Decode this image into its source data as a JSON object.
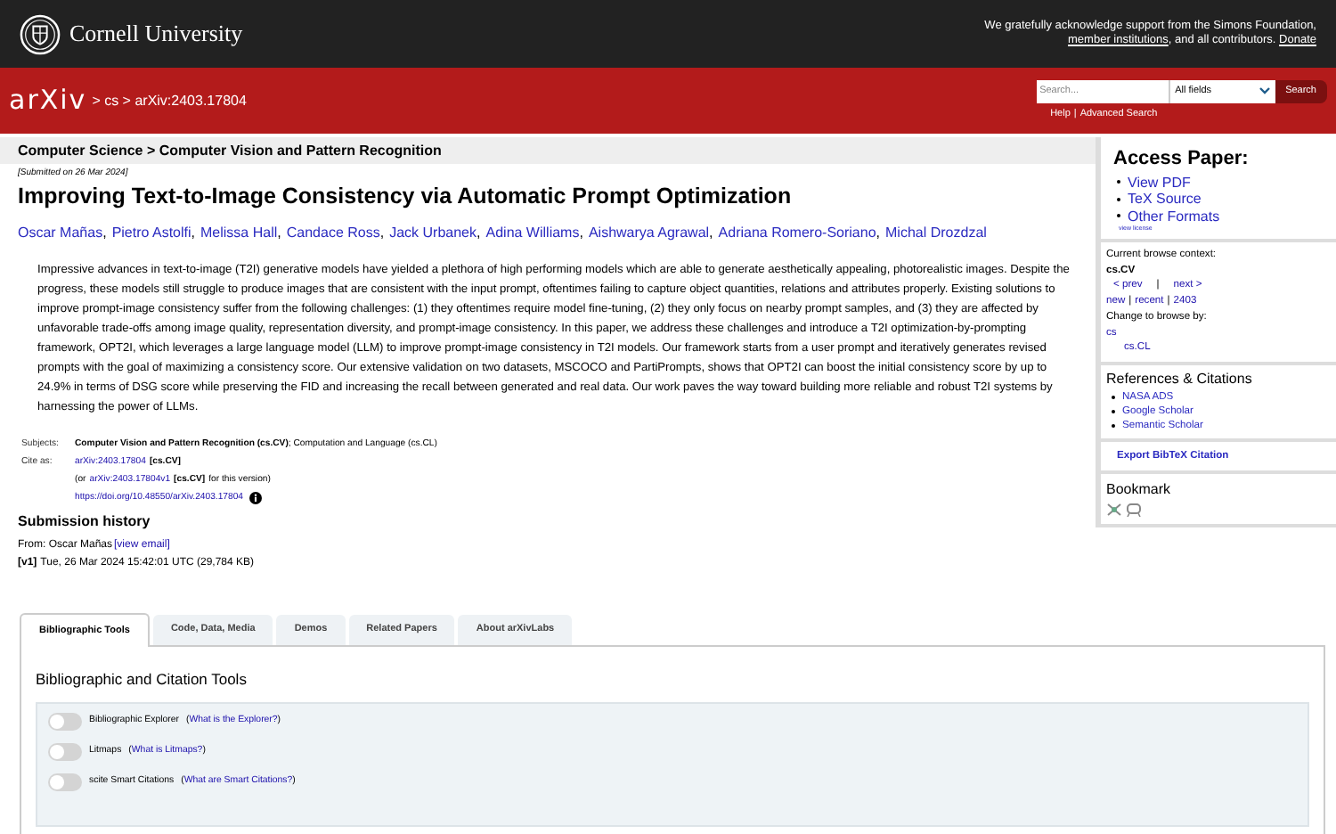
{
  "top_bar": {
    "institution": "Cornell University",
    "acknowledgment": [
      {
        "kind": "text",
        "text": "We gratefully acknowledge support from the Simons Foundation, "
      },
      {
        "kind": "link",
        "text": "member institutions"
      },
      {
        "kind": "text",
        "text": ", and all contributors. "
      },
      {
        "kind": "link",
        "text": "Donate"
      }
    ]
  },
  "nav_bar": {
    "logo": "arXiv",
    "breadcrumb": "> cs > arXiv:2403.17804",
    "search": {
      "placeholder": "Search...",
      "field_select": "All fields",
      "button": "Search"
    },
    "links": [
      "Help",
      "Advanced Search"
    ],
    "separator": "|"
  },
  "subheader": "Computer Science > Computer Vision and Pattern Recognition",
  "paper": {
    "submitted": "[Submitted on 26 Mar 2024]",
    "title": "Improving Text-to-Image Consistency via Automatic Prompt Optimization",
    "authors": [
      "Oscar Mañas",
      "Pietro Astolfi",
      "Melissa Hall",
      "Candace Ross",
      "Jack Urbanek",
      "Adina Williams",
      "Aishwarya Agrawal",
      "Adriana Romero-Soriano",
      "Michal Drozdzal"
    ],
    "author_separator": ",",
    "abstract": "Impressive advances in text-to-image (T2I) generative models have yielded a plethora of high performing models which are able to generate aesthetically appealing, photorealistic images. Despite the progress, these models still struggle to produce images that are consistent with the input prompt, oftentimes failing to capture object quantities, relations and attributes properly. Existing solutions to improve prompt-image consistency suffer from the following challenges: (1) they oftentimes require model fine-tuning, (2) they only focus on nearby prompt samples, and (3) they are affected by unfavorable trade-offs among image quality, representation diversity, and prompt-image consistency. In this paper, we address these challenges and introduce a T2I optimization-by-prompting framework, OPT2I, which leverages a large language model (LLM) to improve prompt-image consistency in T2I models. Our framework starts from a user prompt and iteratively generates revised prompts with the goal of maximizing a consistency score. Our extensive validation on two datasets, MSCOCO and PartiPrompts, shows that OPT2I can boost the initial consistency score by up to 24.9% in terms of DSG score while preserving the FID and increasing the recall between generated and real data. Our work paves the way toward building more reliable and robust T2I systems by harnessing the power of LLMs.",
    "subjects_label": "Subjects:",
    "subjects": "**Computer Vision and Pattern Recognition (cs.CV)**; Computation and Language (cs.CL)",
    "cite_label": "Cite as:",
    "cite_id": "arXiv:2403.17804",
    "cite_tag": "[cs.CV]",
    "version_open": "(or",
    "version_id": "arXiv:2403.17804v1",
    "version_tag": "[cs.CV]",
    "version_close": "for this version)",
    "doi": "https://doi.org/10.48550/arXiv.2403.17804"
  },
  "submission_history": {
    "heading": "Submission history",
    "from": "From: Oscar Mañas",
    "view_email": "[view email]",
    "version_tag": "[v1]",
    "version_text": "Tue, 26 Mar 2024 15:42:01 UTC (29,784 KB)"
  },
  "tabs": [
    {
      "label": "Bibliographic Tools",
      "selected": true
    },
    {
      "label": "Code, Data, Media",
      "selected": false
    },
    {
      "label": "Demos",
      "selected": false
    },
    {
      "label": "Related Papers",
      "selected": false
    },
    {
      "label": "About arXivLabs",
      "selected": false
    }
  ],
  "tools_panel": {
    "heading": "Bibliographic and Citation Tools",
    "paren_open": "(",
    "paren_close": ")",
    "tools": [
      {
        "name": "Bibliographic Explorer",
        "help": "What is the Explorer?",
        "on": false
      },
      {
        "name": "Litmaps",
        "help": "What is Litmaps?",
        "on": false
      },
      {
        "name": "scite Smart Citations",
        "help": "What are Smart Citations?",
        "on": false
      }
    ]
  },
  "sidebar": {
    "access_heading": "Access Paper:",
    "access_links": [
      "View PDF",
      "TeX Source",
      "Other Formats"
    ],
    "license": "view license",
    "context_label": "Current browse context:",
    "context": "cs.CV",
    "prev": "< prev",
    "next": "next >",
    "pipe": "|",
    "browse_links": [
      "new",
      "recent",
      "2403"
    ],
    "change_label": "Change to browse by:",
    "browse_by": [
      "cs",
      "cs.CL"
    ],
    "refs_heading": "References & Citations",
    "refs": [
      "NASA ADS",
      "Google Scholar",
      "Semantic Scholar"
    ],
    "export": "Export BibTeX Citation",
    "bookmark_heading": "Bookmark"
  }
}
